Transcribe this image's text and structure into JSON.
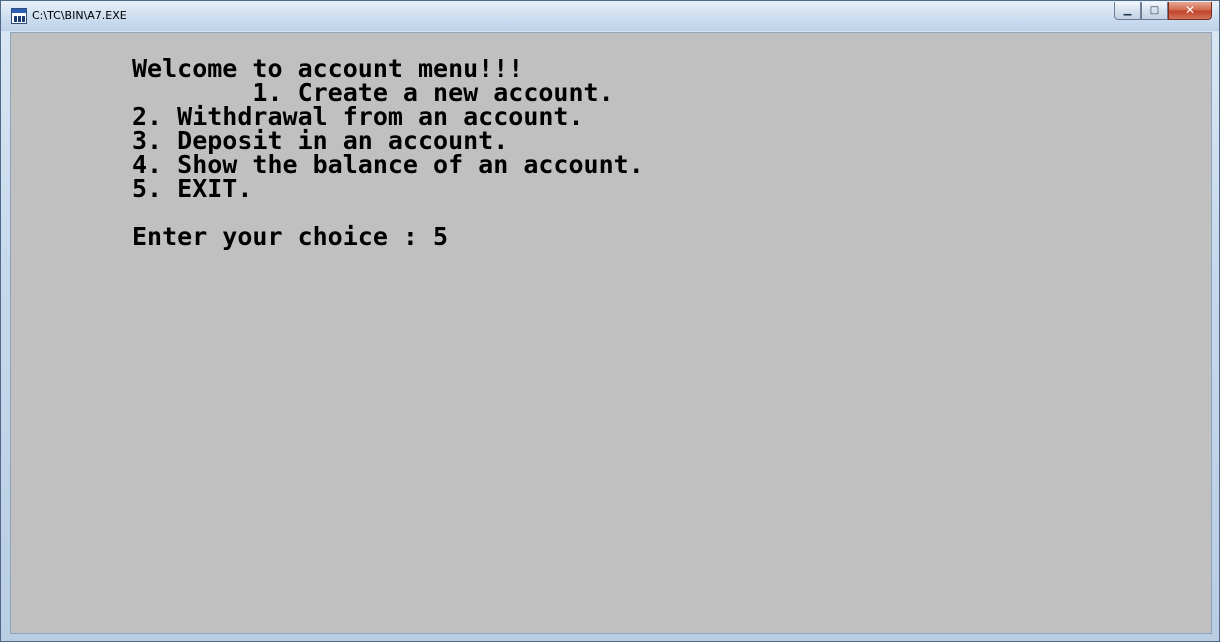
{
  "window": {
    "title": "C:\\TC\\BIN\\A7.EXE",
    "icon": "dos-program-icon",
    "controls": {
      "minimize": "▁",
      "maximize": "□",
      "close": "✕"
    }
  },
  "console": {
    "background": "#c0c0c0",
    "text_color": "#000000",
    "lines": [
      "Welcome to account menu!!!",
      "        1. Create a new account.",
      "2. Withdrawal from an account.",
      "3. Deposit in an account.",
      "4. Show the balance of an account.",
      "5. EXIT.",
      "",
      "Enter your choice : 5"
    ]
  }
}
